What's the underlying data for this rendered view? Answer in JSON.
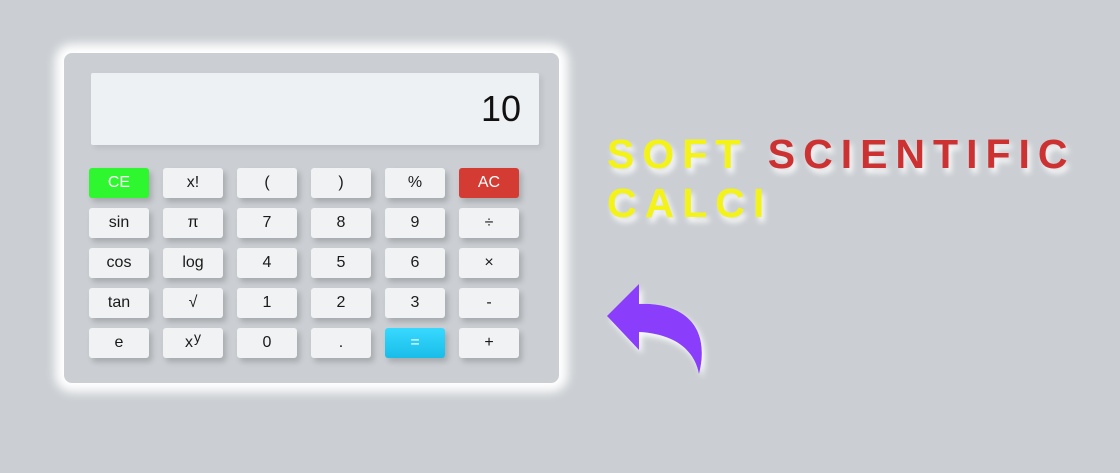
{
  "display": {
    "value": "10"
  },
  "title": {
    "word1": "SOFT",
    "word2": "SCIENTIFIC",
    "word3": "CALCI"
  },
  "keys": {
    "ce": "CE",
    "fact": "x!",
    "lparen": "(",
    "rparen": ")",
    "percent": "%",
    "ac": "AC",
    "sin": "sin",
    "pi": "π",
    "seven": "7",
    "eight": "8",
    "nine": "9",
    "divide": "÷",
    "cos": "cos",
    "log": "log",
    "four": "4",
    "five": "5",
    "six": "6",
    "multiply": "×",
    "tan": "tan",
    "sqrt": "√",
    "one": "1",
    "two": "2",
    "three": "3",
    "minus": "-",
    "e": "e",
    "pow_base": "x",
    "pow_exp": "y",
    "zero": "0",
    "dot": ".",
    "equals": "=",
    "plus": "+"
  },
  "colors": {
    "background": "#cbcfd3",
    "ce_button": "#2ff72f",
    "ac_button": "#d33b33",
    "equals_button": "#29ccf5",
    "title_yellow": "#f3f31a",
    "title_red": "#cd3232",
    "arrow": "#8a3dfa"
  },
  "icons": {
    "arrow": "back-arrow-icon"
  }
}
